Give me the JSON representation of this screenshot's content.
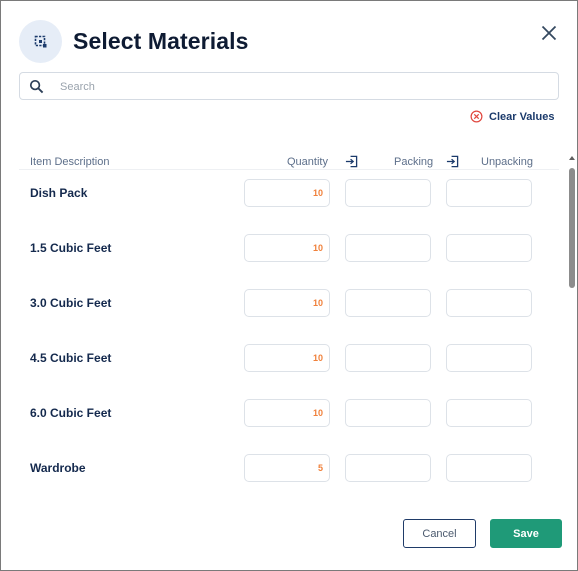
{
  "dialog": {
    "title": "Select Materials",
    "header_icon": "floor-plan-icon",
    "close_icon": "close-icon"
  },
  "search": {
    "placeholder": "Search",
    "value": "",
    "icon": "search-icon"
  },
  "actions": {
    "clear_values_label": "Clear Values",
    "clear_icon": "circle-x-icon"
  },
  "table": {
    "columns": {
      "item_description": "Item Description",
      "quantity": "Quantity",
      "packing": "Packing",
      "unpacking": "Unpacking"
    },
    "copy_icon": "copy-column-icon",
    "rows": [
      {
        "label": "Dish Pack",
        "quantity": "10",
        "packing": "",
        "unpacking": ""
      },
      {
        "label": "1.5 Cubic Feet",
        "quantity": "10",
        "packing": "",
        "unpacking": ""
      },
      {
        "label": "3.0 Cubic Feet",
        "quantity": "10",
        "packing": "",
        "unpacking": ""
      },
      {
        "label": "4.5 Cubic Feet",
        "quantity": "10",
        "packing": "",
        "unpacking": ""
      },
      {
        "label": "6.0 Cubic Feet",
        "quantity": "10",
        "packing": "",
        "unpacking": ""
      },
      {
        "label": "Wardrobe",
        "quantity": "5",
        "packing": "",
        "unpacking": ""
      }
    ]
  },
  "footer": {
    "cancel_label": "Cancel",
    "save_label": "Save"
  },
  "colors": {
    "title": "#0e1b33",
    "quantity_value": "#f0813b",
    "save_button": "#1f9a78",
    "clear_icon": "#e0473f"
  }
}
